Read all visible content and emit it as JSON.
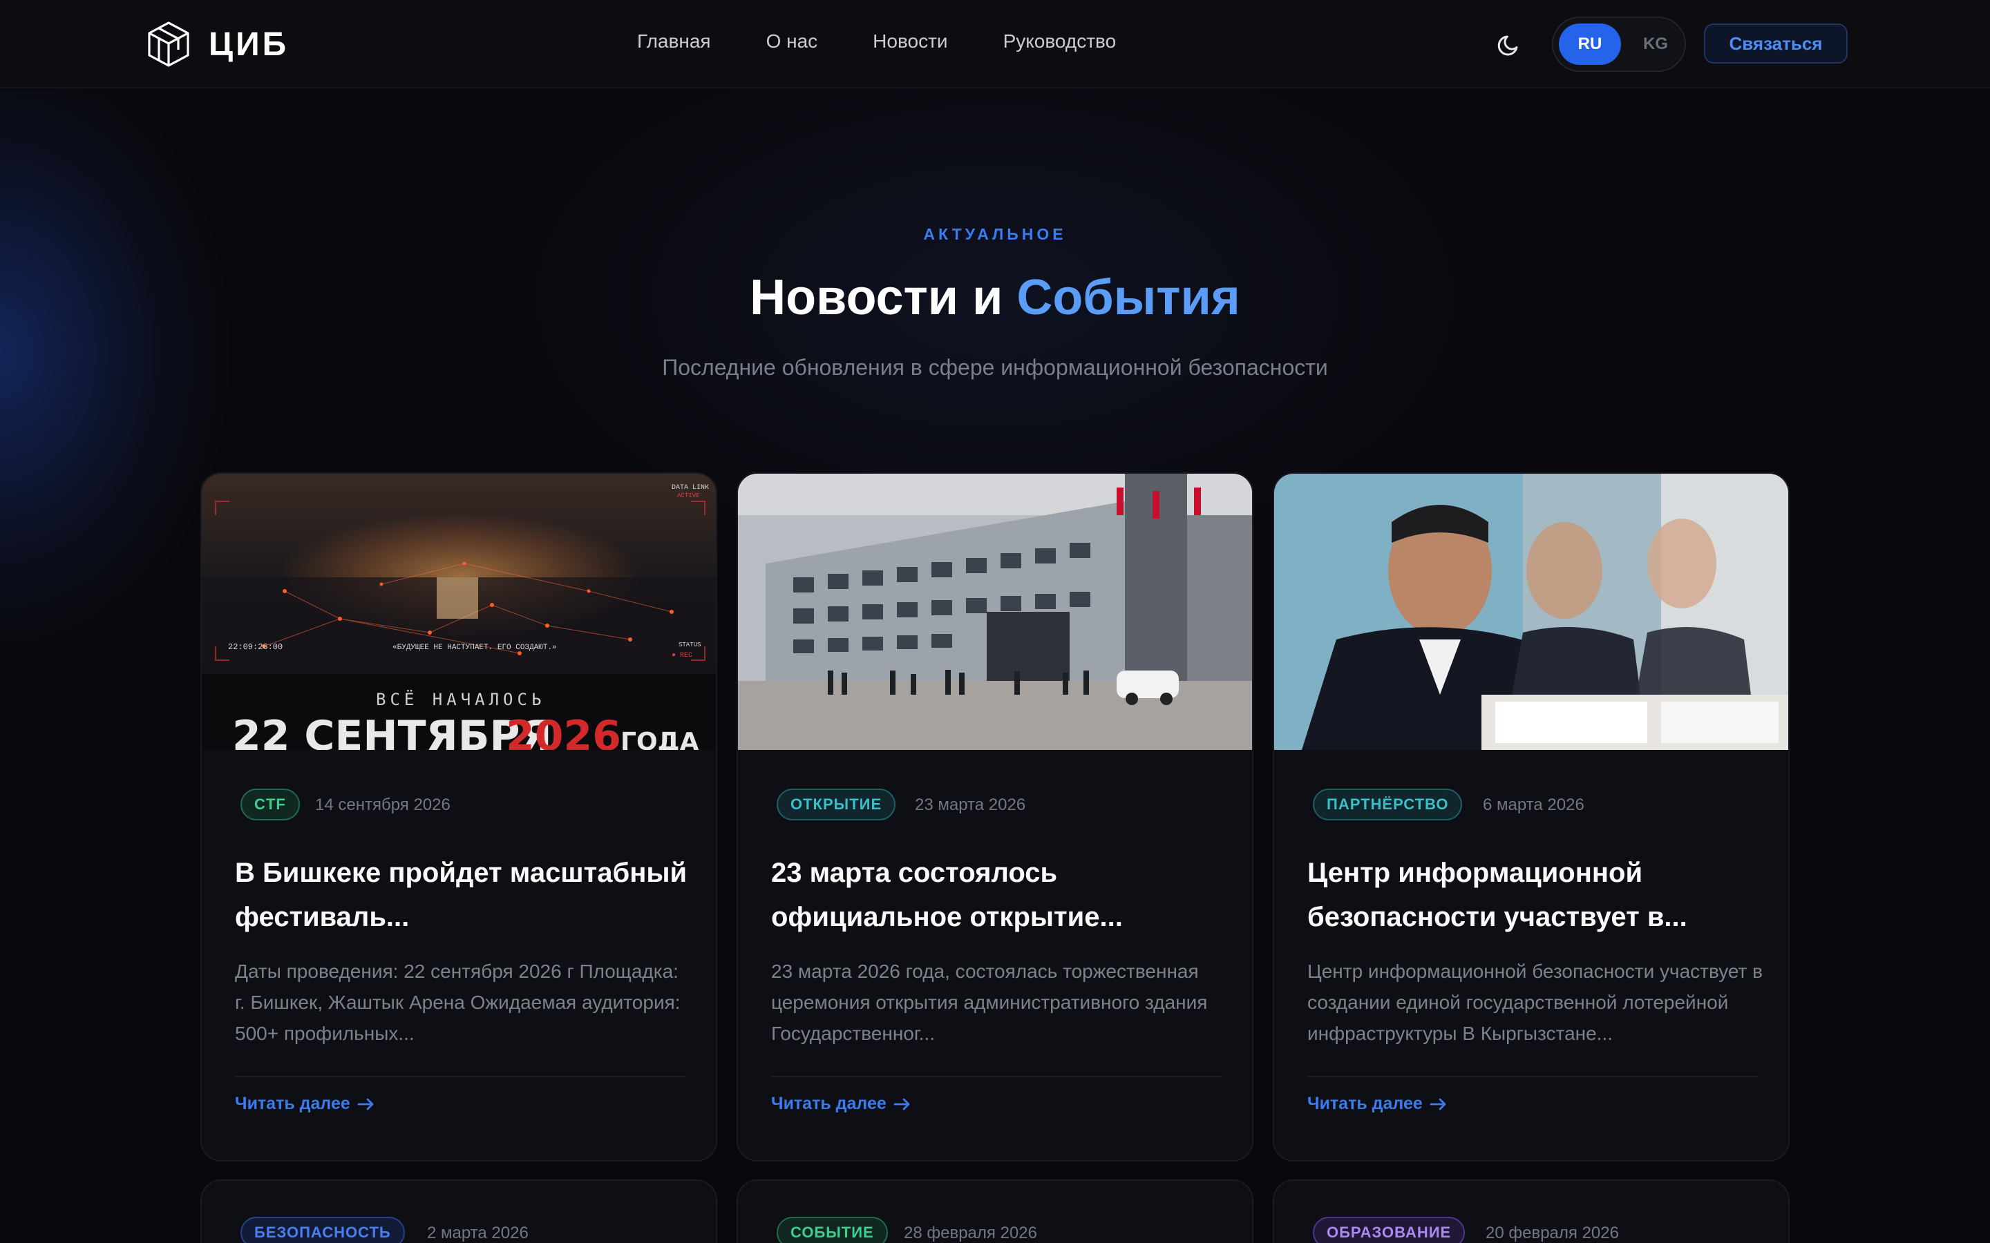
{
  "nav": {
    "logo_text": "ЦИБ",
    "menu": [
      "Главная",
      "О нас",
      "Новости",
      "Руководство"
    ],
    "lang_active": "RU",
    "lang_other": "KG",
    "contact_label": "Связаться"
  },
  "header": {
    "eyebrow": "АКТУАЛЬНОЕ",
    "title_main": "Новости и ",
    "title_accent": "События",
    "subtitle": "Последние обновления в сфере информационной безопасности"
  },
  "cards": [
    {
      "badge": "CTF",
      "date": "14 сентября 2026",
      "title": "В Бишкеке пройдет масштабный фестиваль...",
      "text": "Даты проведения: 22 сентября 2026 г Площадка: г. Бишкек, Жаштык Арена Ожидаемая аудитория: 500+ профильных...",
      "read_more": "Читать далее",
      "image_text": {
        "top_right": "DATA LINK",
        "top_right_sub": "ACTIVE",
        "time": "22:09:26:00",
        "quote": "«БУДУЩЕЕ НЕ НАСТУПАЕТ. ЕГО СОЗДАЮТ.»",
        "status": "STATUS",
        "rec": "● REC",
        "started": "ВСЁ НАЧАЛОСЬ",
        "date_big_a": "22 СЕНТЯБРЯ",
        "date_big_b": "2026",
        "date_big_c": "ГОДА"
      }
    },
    {
      "badge": "ОТКРЫТИЕ",
      "date": "23 марта 2026",
      "title": "23 марта состоялось официальное открытие...",
      "text": "23 марта 2026 года, состоялась торжественная церемония открытия административного здания Государственног...",
      "read_more": "Читать далее"
    },
    {
      "badge": "ПАРТНЁРСТВО",
      "date": "6 марта 2026",
      "title": "Центр информационной безопасности участвует в...",
      "text": "Центр информационной безопасности участвует в создании единой государственной лотерейной инфраструктуры В Кыргызстане...",
      "read_more": "Читать далее"
    }
  ],
  "row2": [
    {
      "badge": "БЕЗОПАСНОСТЬ",
      "date": "2 марта 2026"
    },
    {
      "badge": "СОБЫТИЕ",
      "date": "28 февраля 2026"
    },
    {
      "badge": "ОБРАЗОВАНИЕ",
      "date": "20 февраля 2026"
    }
  ],
  "colors": {
    "accent": "#3b7bf0",
    "title_accent": "#5b9cf7",
    "background": "#09090d",
    "card": "#0e0f14"
  },
  "icons": [
    "logo-cube-icon",
    "moon-icon",
    "arrow-right-icon"
  ]
}
